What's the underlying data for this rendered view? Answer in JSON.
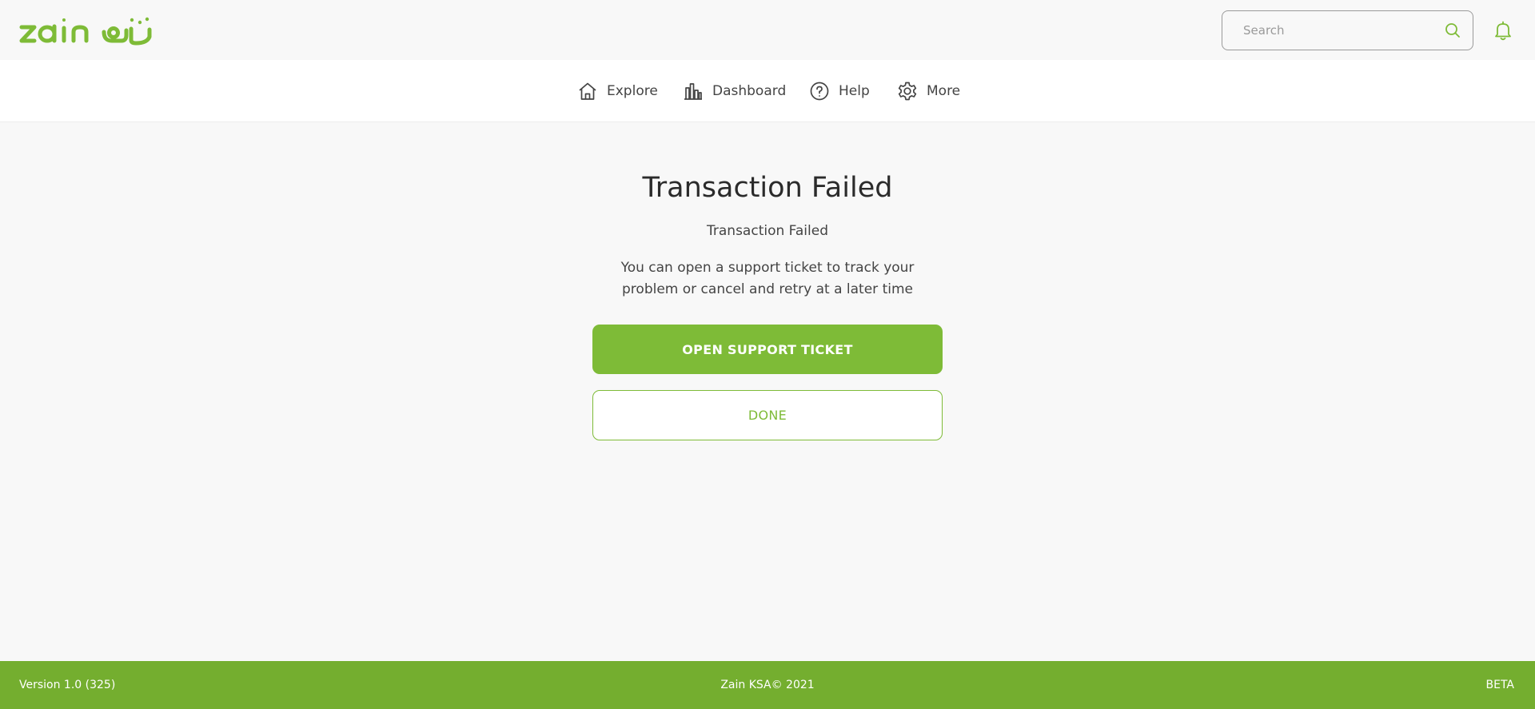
{
  "header": {
    "logo_alt": "zain زين",
    "search": {
      "placeholder": "Search",
      "value": ""
    },
    "icons": {
      "search": "search-icon",
      "notifications": "bell-icon"
    }
  },
  "nav": {
    "items": [
      {
        "label": "Explore",
        "icon": "home-icon"
      },
      {
        "label": "Dashboard",
        "icon": "bar-chart-icon"
      },
      {
        "label": "Help",
        "icon": "help-circle-icon"
      },
      {
        "label": "More",
        "icon": "gear-icon"
      }
    ]
  },
  "main": {
    "title": "Transaction Failed",
    "subtitle": "Transaction Failed",
    "message": "You can open a support ticket to track your problem or cancel and retry at a later time",
    "primary_button": "OPEN SUPPORT TICKET",
    "secondary_button": "DONE"
  },
  "footer": {
    "version": "Version 1.0 (325)",
    "copyright": "Zain KSA© 2021",
    "badge": "BETA"
  },
  "colors": {
    "brand_green": "#7ebb37",
    "footer_green": "#74ae2f",
    "background": "#f8f8f8",
    "text": "#333333"
  }
}
